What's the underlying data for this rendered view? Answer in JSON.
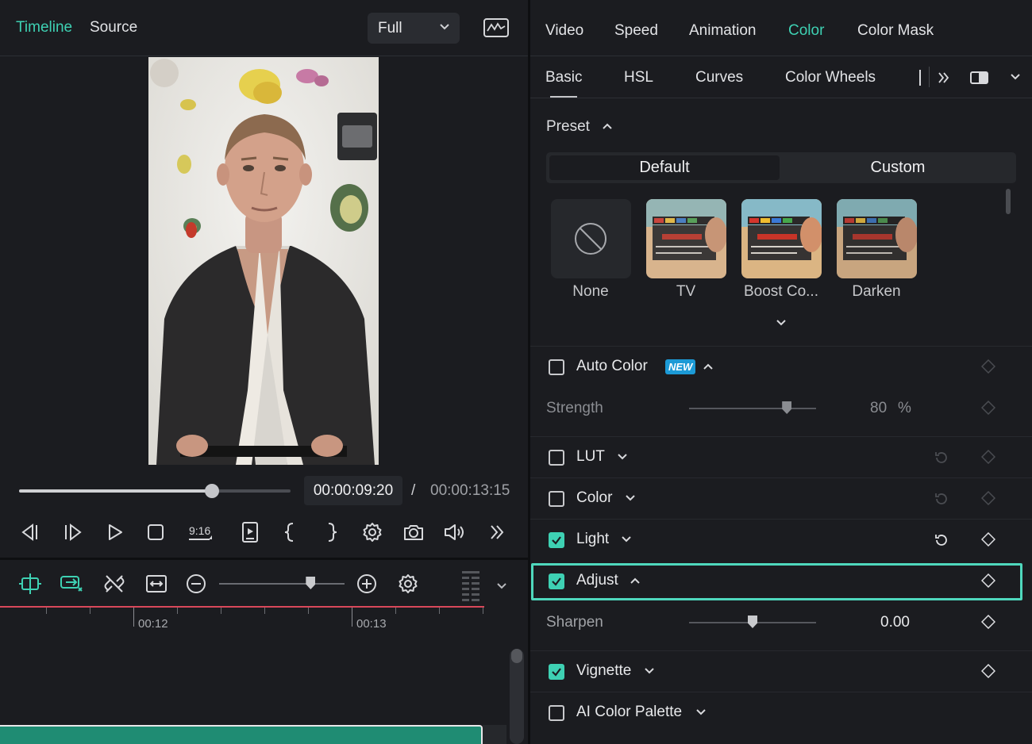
{
  "left": {
    "tabs": [
      {
        "label": "Timeline",
        "color": "#3ed1b3"
      },
      {
        "label": "Source",
        "color": "#e2e3e6"
      }
    ],
    "quality_select": "Full",
    "playback": {
      "current_time": "00:00:09:20",
      "separator": "/",
      "total_time": "00:00:13:15",
      "progress": 0.71
    },
    "controls": [
      "prev-frame-icon",
      "next-frame-icon",
      "play-icon",
      "stop-icon",
      "aspect-ratio-icon",
      "render-preview-icon",
      "mark-in-icon",
      "mark-out-icon",
      "settings-icon",
      "snapshot-icon",
      "volume-icon",
      "more-icon"
    ],
    "aspect_label": "9:16",
    "timeline_tools": [
      "auto-snap-icon",
      "link-clips-icon",
      "unlink-icon",
      "fit-timeline-icon",
      "zoom-out-icon",
      "zoom-in-icon",
      "timeline-settings-icon"
    ],
    "zoom_level": 0.73,
    "ruler_labels": [
      "00:12",
      "00:13"
    ]
  },
  "right": {
    "tabs": [
      {
        "label": "Video",
        "active": false
      },
      {
        "label": "Speed",
        "active": false
      },
      {
        "label": "Animation",
        "active": false
      },
      {
        "label": "Color",
        "active": true
      },
      {
        "label": "Color Mask",
        "active": false
      }
    ],
    "subtabs": [
      {
        "label": "Basic",
        "active": true
      },
      {
        "label": "HSL",
        "active": false
      },
      {
        "label": "Curves",
        "active": false
      },
      {
        "label": "Color Wheels",
        "active": false
      }
    ],
    "accent": "#3ed1b3",
    "preset": {
      "label": "Preset",
      "segments": [
        {
          "label": "Default",
          "active": true
        },
        {
          "label": "Custom",
          "active": false
        }
      ],
      "items": [
        {
          "label": "None"
        },
        {
          "label": "TV"
        },
        {
          "label": "Boost Co..."
        },
        {
          "label": "Darken"
        }
      ]
    },
    "auto_color": {
      "label": "Auto Color",
      "badge": "NEW",
      "checked": false
    },
    "strength": {
      "label": "Strength",
      "value": "80",
      "unit": "%",
      "level": 0.77
    },
    "sections": [
      {
        "label": "LUT",
        "checked": false
      },
      {
        "label": "Color",
        "checked": false
      },
      {
        "label": "Light",
        "checked": true
      },
      {
        "label": "Adjust",
        "checked": true
      }
    ],
    "sharpen": {
      "label": "Sharpen",
      "value": "0.00",
      "level": 0.5
    },
    "vignette": {
      "label": "Vignette",
      "checked": true
    },
    "ai_palette": {
      "label": "AI Color Palette",
      "checked": false
    }
  }
}
